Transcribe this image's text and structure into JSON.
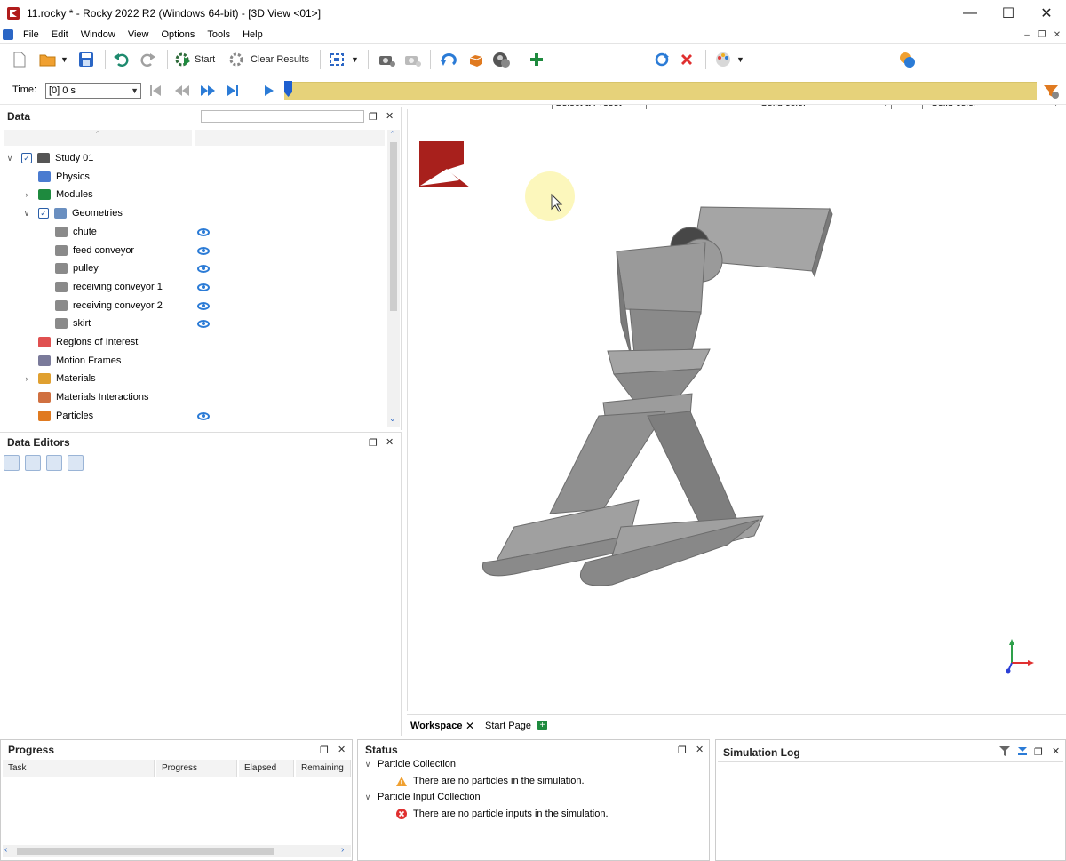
{
  "window": {
    "title": "11.rocky * - Rocky 2022 R2 (Windows 64-bit) - [3D View <01>]",
    "minimize": "—",
    "maximize": "☐",
    "close": "✕"
  },
  "menu": {
    "items": [
      "File",
      "Edit",
      "Window",
      "View",
      "Options",
      "Tools",
      "Help"
    ]
  },
  "toolbar": {
    "start_label": "Start",
    "clear_results_label": "Clear Results",
    "preset_value": "Select a Preset",
    "color1_value": "<Solid color>",
    "color2_value": "<Solid color>"
  },
  "timebar": {
    "time_label": "Time:",
    "time_value": "[0] 0 s",
    "progress_fraction": 0.0
  },
  "data_panel": {
    "title": "Data",
    "search_placeholder": "",
    "tree": [
      {
        "label": "Study 01",
        "level": 0,
        "expander": "∨",
        "checkbox": true,
        "icon": "study-icon",
        "eye": false
      },
      {
        "label": "Physics",
        "level": 1,
        "expander": "",
        "checkbox": false,
        "icon": "physics-icon",
        "eye": false
      },
      {
        "label": "Modules",
        "level": 1,
        "expander": "›",
        "checkbox": false,
        "icon": "modules-icon",
        "eye": false
      },
      {
        "label": "Geometries",
        "level": 1,
        "expander": "∨",
        "checkbox": true,
        "icon": "geometries-icon",
        "eye": false
      },
      {
        "label": "chute",
        "level": 2,
        "expander": "",
        "checkbox": false,
        "icon": "geometry-icon",
        "eye": true
      },
      {
        "label": "feed conveyor",
        "level": 2,
        "expander": "",
        "checkbox": false,
        "icon": "geometry-icon",
        "eye": true
      },
      {
        "label": "pulley",
        "level": 2,
        "expander": "",
        "checkbox": false,
        "icon": "geometry-icon",
        "eye": true
      },
      {
        "label": "receiving conveyor 1",
        "level": 2,
        "expander": "",
        "checkbox": false,
        "icon": "geometry-icon",
        "eye": true
      },
      {
        "label": "receiving conveyor 2",
        "level": 2,
        "expander": "",
        "checkbox": false,
        "icon": "geometry-icon",
        "eye": true
      },
      {
        "label": "skirt",
        "level": 2,
        "expander": "",
        "checkbox": false,
        "icon": "geometry-icon",
        "eye": true
      },
      {
        "label": "Regions of Interest",
        "level": 1,
        "expander": "",
        "checkbox": false,
        "icon": "regions-icon",
        "eye": false
      },
      {
        "label": "Motion Frames",
        "level": 1,
        "expander": "",
        "checkbox": false,
        "icon": "motion-frames-icon",
        "eye": false
      },
      {
        "label": "Materials",
        "level": 1,
        "expander": "›",
        "checkbox": false,
        "icon": "materials-icon",
        "eye": false
      },
      {
        "label": "Materials Interactions",
        "level": 1,
        "expander": "",
        "checkbox": false,
        "icon": "materials-interactions-icon",
        "eye": false
      },
      {
        "label": "Particles",
        "level": 1,
        "expander": "",
        "checkbox": false,
        "icon": "particles-icon",
        "eye": true
      }
    ]
  },
  "data_editors": {
    "title": "Data Editors"
  },
  "view_tabs": {
    "workspace": "Workspace",
    "start_page": "Start Page"
  },
  "progress_panel": {
    "title": "Progress",
    "columns": [
      "Task",
      "Progress",
      "Elapsed",
      "Remaining"
    ]
  },
  "status_panel": {
    "title": "Status",
    "groups": [
      {
        "label": "Particle Collection",
        "message": "There are no particles in the simulation.",
        "severity": "warning"
      },
      {
        "label": "Particle Input Collection",
        "message": "There are no particle inputs in the simulation.",
        "severity": "error"
      }
    ]
  },
  "simlog_panel": {
    "title": "Simulation Log"
  },
  "colors": {
    "brand_red": "#b01c1c",
    "timeline_yellow": "#e6d27a",
    "accent_blue": "#2b7bd6"
  }
}
